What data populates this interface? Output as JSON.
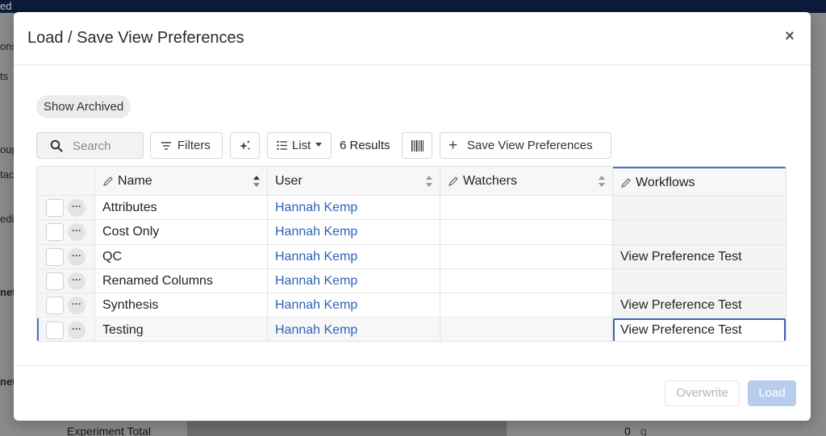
{
  "background": {
    "left_fragments": [
      "ed",
      "ons",
      "ts",
      "oup",
      "tac",
      "edi",
      "net",
      "net"
    ],
    "experiment_label": "Experiment Total",
    "experiment_value": "0",
    "experiment_unit": "g"
  },
  "modal": {
    "title": "Load / Save View Preferences",
    "close_label": "×"
  },
  "toolbar": {
    "show_archived": "Show Archived",
    "search_placeholder": "Search",
    "filters_label": "Filters",
    "list_label": "List",
    "results_label": "6 Results",
    "save_label": "Save View Preferences"
  },
  "table": {
    "columns": [
      "Name",
      "User",
      "Watchers",
      "Workflows"
    ],
    "rows": [
      {
        "name": "Attributes",
        "user": "Hannah Kemp",
        "watchers": "",
        "workflows": ""
      },
      {
        "name": "Cost Only",
        "user": "Hannah Kemp",
        "watchers": "",
        "workflows": ""
      },
      {
        "name": "QC",
        "user": "Hannah Kemp",
        "watchers": "",
        "workflows": "View Preference Test"
      },
      {
        "name": "Renamed Columns",
        "user": "Hannah Kemp",
        "watchers": "",
        "workflows": ""
      },
      {
        "name": "Synthesis",
        "user": "Hannah Kemp",
        "watchers": "",
        "workflows": "View Preference Test"
      },
      {
        "name": "Testing",
        "user": "Hannah Kemp",
        "watchers": "",
        "workflows": "View Preference Test"
      }
    ],
    "row_menu_label": "···"
  },
  "footer": {
    "overwrite_label": "Overwrite",
    "load_label": "Load"
  },
  "colors": {
    "accent": "#3a62b4",
    "link": "#2f63b8",
    "load_disabled": "#b8cdee"
  }
}
